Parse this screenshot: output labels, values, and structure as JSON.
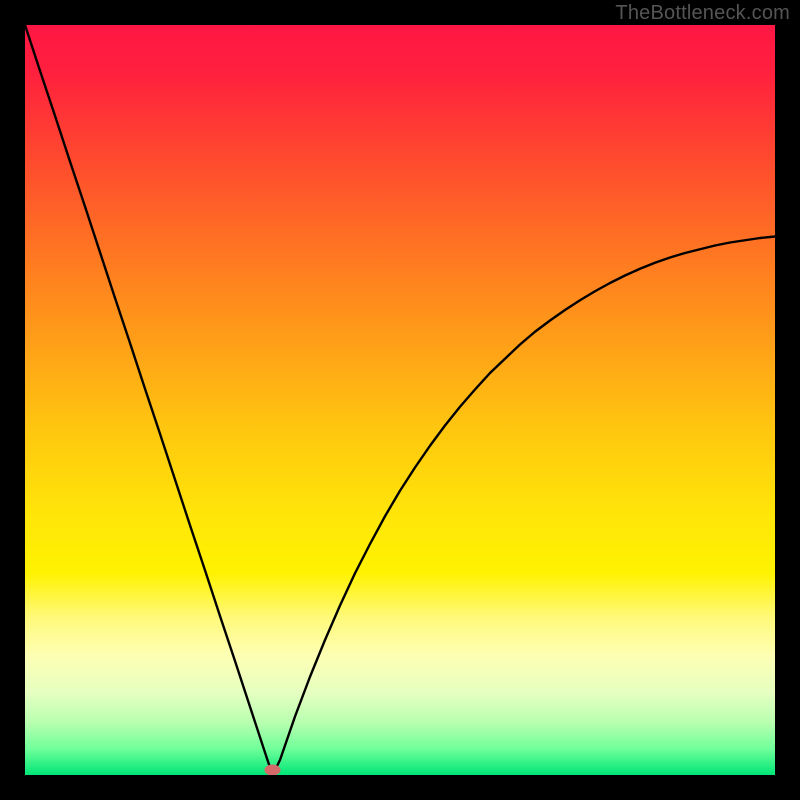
{
  "watermark": "TheBottleneck.com",
  "chart_data": {
    "type": "line",
    "title": "",
    "xlabel": "",
    "ylabel": "",
    "xlim": [
      0,
      1
    ],
    "ylim": [
      0,
      1
    ],
    "minimum_x": 0.33,
    "marker": {
      "x": 0.33,
      "y": 0.0
    },
    "background_gradient": {
      "stops": [
        {
          "offset": 0.0,
          "color": "#ff1744"
        },
        {
          "offset": 0.06,
          "color": "#ff1f3e"
        },
        {
          "offset": 0.18,
          "color": "#ff4a2e"
        },
        {
          "offset": 0.3,
          "color": "#ff7522"
        },
        {
          "offset": 0.42,
          "color": "#ff9e18"
        },
        {
          "offset": 0.54,
          "color": "#ffc70f"
        },
        {
          "offset": 0.66,
          "color": "#ffe708"
        },
        {
          "offset": 0.73,
          "color": "#fff200"
        },
        {
          "offset": 0.79,
          "color": "#fff97a"
        },
        {
          "offset": 0.84,
          "color": "#fdffb3"
        },
        {
          "offset": 0.89,
          "color": "#e6ffc0"
        },
        {
          "offset": 0.93,
          "color": "#b8ffb0"
        },
        {
          "offset": 0.965,
          "color": "#70ff9a"
        },
        {
          "offset": 1.0,
          "color": "#00e676"
        }
      ]
    },
    "x": [
      0.0,
      0.02,
      0.04,
      0.06,
      0.08,
      0.1,
      0.12,
      0.14,
      0.16,
      0.18,
      0.2,
      0.22,
      0.24,
      0.26,
      0.28,
      0.3,
      0.32,
      0.33,
      0.34,
      0.36,
      0.38,
      0.4,
      0.42,
      0.44,
      0.46,
      0.48,
      0.5,
      0.52,
      0.54,
      0.56,
      0.58,
      0.6,
      0.62,
      0.64,
      0.66,
      0.68,
      0.7,
      0.72,
      0.74,
      0.76,
      0.78,
      0.8,
      0.82,
      0.84,
      0.86,
      0.88,
      0.9,
      0.92,
      0.94,
      0.96,
      0.98,
      1.0
    ],
    "y": [
      1.0,
      0.939,
      0.879,
      0.818,
      0.758,
      0.697,
      0.636,
      0.576,
      0.515,
      0.455,
      0.394,
      0.333,
      0.273,
      0.212,
      0.152,
      0.091,
      0.03,
      0.0,
      0.02,
      0.078,
      0.131,
      0.18,
      0.226,
      0.269,
      0.308,
      0.345,
      0.379,
      0.41,
      0.439,
      0.466,
      0.491,
      0.514,
      0.536,
      0.555,
      0.574,
      0.591,
      0.606,
      0.62,
      0.633,
      0.645,
      0.656,
      0.666,
      0.675,
      0.683,
      0.69,
      0.696,
      0.701,
      0.706,
      0.71,
      0.713,
      0.716,
      0.718
    ]
  }
}
